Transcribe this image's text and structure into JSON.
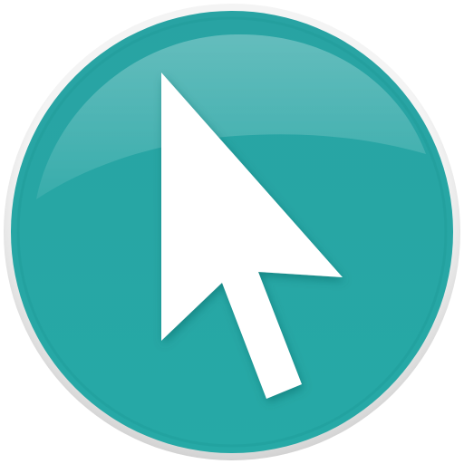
{
  "icon": {
    "name": "cursor-arrow-icon",
    "shape": "circular-button",
    "colors": {
      "background": "#ffffff",
      "button_outer": "#26A9A6",
      "button_inner": "#28A3A3",
      "button_rim": "#E4E4E4",
      "highlight": "#FFFFFF",
      "cursor_fill": "#FFFFFF",
      "cursor_shadow": "#0F5E5C"
    }
  }
}
